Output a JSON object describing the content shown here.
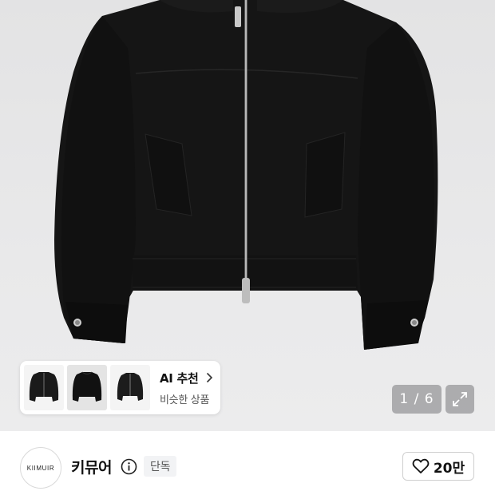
{
  "product": {
    "image_alt": "black zip-up jacket"
  },
  "ai_recommend": {
    "title": "AI 추천",
    "subtitle": "비슷한 상품",
    "thumbnails": [
      "jacket-thumb-1",
      "jacket-thumb-2",
      "jacket-thumb-3"
    ]
  },
  "gallery": {
    "counter": "1 / 6",
    "expand_icon": "expand-icon"
  },
  "brand": {
    "logo_text": "KIIMUIR",
    "name": "키뮤어",
    "badge": "단독",
    "info_icon": "info-icon"
  },
  "like": {
    "icon": "heart-icon",
    "count": "20만"
  },
  "colors": {
    "background": "#e9e9ea",
    "jacket": "#151515",
    "overlay": "#78787c"
  }
}
